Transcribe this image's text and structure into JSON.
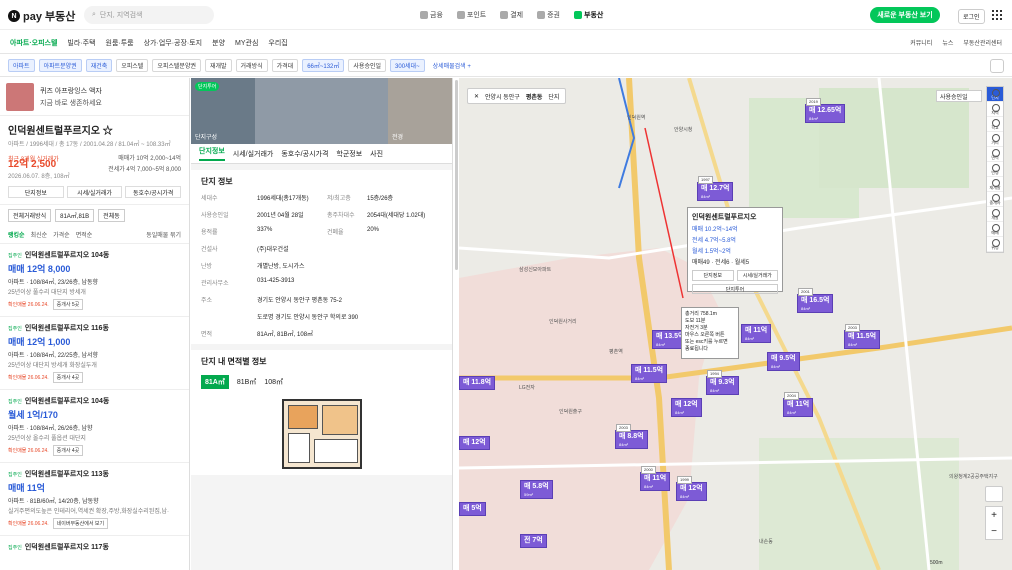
{
  "app": {
    "logo_n": "N",
    "logo_text": "pay 부동산",
    "search_placeholder": "단지, 지역검색",
    "new_button": "새로운 부동산 보기",
    "login": "로그인"
  },
  "services": [
    "금융",
    "포인트",
    "결제",
    "증권",
    "부동산"
  ],
  "nav": {
    "items": [
      "아파트·오피스텔",
      "빌라·주택",
      "원룸·투룸",
      "상가·업무·공장·토지",
      "분양",
      "MY관심",
      "우리집"
    ],
    "right": [
      "커뮤니티",
      "뉴스",
      "부동산관리센터"
    ]
  },
  "filters": [
    "아파트",
    "아파트분양권",
    "재건축",
    "오피스텔",
    "오피스텔분양권",
    "재개발",
    "거래방식",
    "가격대",
    "66㎡~132㎡",
    "사용승인일",
    "300세대~",
    "상세매물검색 +"
  ],
  "promo": {
    "line1": "퀴즈 아프랑잉스 액자",
    "line2": "지금 바로 생존하세요"
  },
  "complex": {
    "name": "인덕원센트럴푸르지오 ☆",
    "sub": "아파트 / 1996세대 / 총 17동 / 2001.04.28 / 81.04㎡ ~ 108.33㎡",
    "recent_label": "최근 3개월 실거래가",
    "price": "12억 2,500",
    "date": "2026.06.07. 8층, 108㎡",
    "sale": "매매가 10억 2,000~14억",
    "rent": "전세가 4억 7,000~5억 8,000",
    "tabs": [
      "단지정보",
      "시세/실거래가",
      "동호수/공시가격"
    ]
  },
  "selects": [
    "전체거래방식",
    "81A㎡,81B",
    "전체동"
  ],
  "sort": [
    "랭킹순",
    "최신순",
    "가격순",
    "면적순",
    "동일매물 묶기"
  ],
  "listings": [
    {
      "tag": "집주인",
      "title": "인덕원센트럴푸르지오 104동",
      "price": "매매 12억 8,000",
      "d1": "아파트 · 108/84㎡, 23/26층, 남동향",
      "d2": "25년이상 풀수리 대단지 방세개",
      "date": "확인매물 26.06.24.",
      "btn": "중개사 5곳"
    },
    {
      "tag": "집주인",
      "title": "인덕원센트럴푸르지오 116동",
      "price": "매매 12억 1,000",
      "d1": "아파트 · 108/84㎡, 22/25층, 남서향",
      "d2": "25년이상 대단지 방세개 화장실두개",
      "date": "확인매물 26.06.24.",
      "btn": "중개사 4곳"
    },
    {
      "tag": "집주인",
      "title": "인덕원센트럴푸르지오 104동",
      "price": "월세 1억/170",
      "d1": "아파트 · 108/84㎡, 26/26층, 남향",
      "d2": "25년이상 올수리 풀옵션 대단지",
      "date": "확인매물 26.06.24.",
      "btn": "중개사 4곳"
    },
    {
      "tag": "집주인",
      "title": "인덕원센트럴푸르지오 113동",
      "price": "매매 11억",
      "d1": "아파트 · 81B/60㎡, 14/20층, 남동향",
      "d2": "실거주편의도높은 인테리어,역세권 확장,주방,화장실수리된집,남·",
      "date": "확인매물 26.06.24.",
      "btn": "네이버부동산에서 보기"
    },
    {
      "tag": "집주인",
      "title": "인덕원센트럴푸르지오 117동",
      "price": "",
      "d1": "",
      "d2": "",
      "date": "",
      "btn": ""
    }
  ],
  "photos": {
    "badge": "단지투어",
    "cap1": "단지구성",
    "cap2": "전경"
  },
  "mid_tabs": [
    "단지정보",
    "시세/실거래가",
    "동호수/공시가격",
    "학군정보",
    "사진"
  ],
  "info": {
    "title": "단지 정보",
    "rows": [
      [
        "세대수",
        "1996세대(총17개동)",
        "저/최고층",
        "15층/26층"
      ],
      [
        "사용승인일",
        "2001년 04월 28일",
        "총주차대수",
        "2054대(세대당 1.02대)"
      ],
      [
        "용적률",
        "337%",
        "건폐율",
        "20%"
      ],
      [
        "건설사",
        "(주)대우건설",
        "",
        ""
      ],
      [
        "난방",
        "개별난방, 도시가스",
        "",
        ""
      ],
      [
        "관리사무소",
        "031-425-3913",
        "",
        ""
      ],
      [
        "주소",
        "경기도 안양시 동안구 평촌동 75-2",
        "",
        ""
      ],
      [
        "",
        "도로명 경기도 안양시 동안구 학의로 390",
        "",
        ""
      ],
      [
        "면적",
        "81A㎡, 81B㎡, 108㎡",
        "",
        ""
      ]
    ]
  },
  "area": {
    "title": "단지 내 면적별 정보",
    "tabs": [
      "81A㎡",
      "81B㎡",
      "108㎡"
    ]
  },
  "map": {
    "crumb": [
      "안양시 동안구",
      "평촌동",
      "단지"
    ],
    "market_select": "사용승인일",
    "tools": [
      "단지",
      "지적",
      "학교",
      "거리",
      "면적",
      "반경",
      "재개발",
      "중개사",
      "개발",
      "매매",
      "위성"
    ],
    "popup": {
      "title": "인덕원센트럴푸르지오",
      "l1": "매매 10.2억~14억",
      "l2": "전세 4.7억~5.8억",
      "l3": "월세 1.5억~2억",
      "counts": "매매49 · 전세6 · 월세5",
      "b1": "단지정보",
      "b2": "시세/실거래가",
      "tour": "단지투어"
    },
    "popup2": {
      "l1": "총거리 758.1m",
      "l2": "도보 11분",
      "l3": "자전거 3분",
      "l4": "마우스 오른쪽 버튼",
      "l5": "또는 esc키를 누르면",
      "l6": "종료됩니다"
    },
    "markers": [
      {
        "yr": "2019",
        "t": "매 12.65억",
        "ar": "84m²"
      },
      {
        "yr": "1997",
        "t": "매 12.7억",
        "ar": "84m²"
      },
      {
        "yr": "2001",
        "t": "매 16.5억",
        "ar": "84m²"
      },
      {
        "yr": "",
        "t": "매 13.5억",
        "ar": "84m²"
      },
      {
        "yr": "",
        "t": "매 11억",
        "ar": "84m²"
      },
      {
        "yr": "2003",
        "t": "매 11.5억",
        "ar": "84m²"
      },
      {
        "yr": "",
        "t": "매 11.5억",
        "ar": "84m²"
      },
      {
        "yr": "",
        "t": "매 9.5억",
        "ar": "84m²"
      },
      {
        "yr": "1994",
        "t": "매 9.3억",
        "ar": "84m²"
      },
      {
        "yr": "2004",
        "t": "매 11억",
        "ar": "84m²"
      },
      {
        "yr": "",
        "t": "매 12억",
        "ar": "84m²"
      },
      {
        "yr": "2003",
        "t": "매 8.8억",
        "ar": "84m²"
      },
      {
        "yr": "1999",
        "t": "매 12억",
        "ar": "84m²"
      },
      {
        "yr": "2000",
        "t": "매 11억",
        "ar": "84m²"
      },
      {
        "yr": "",
        "t": "매 5.8억",
        "ar": "59m²"
      },
      {
        "yr": "",
        "t": "매 11.8억",
        "ar": ""
      },
      {
        "yr": "",
        "t": "전 7억",
        "ar": ""
      },
      {
        "yr": "",
        "t": "매 12억",
        "ar": ""
      },
      {
        "yr": "",
        "t": "매 5억",
        "ar": ""
      }
    ],
    "labels": [
      "인덕원역",
      "안양시청",
      "삼성신모아파트",
      "인덕원사거리",
      "LG전자",
      "인덕원출구",
      "평촌역",
      "내손동",
      "의왕청계2공공주택지구"
    ],
    "scale": "500m"
  }
}
